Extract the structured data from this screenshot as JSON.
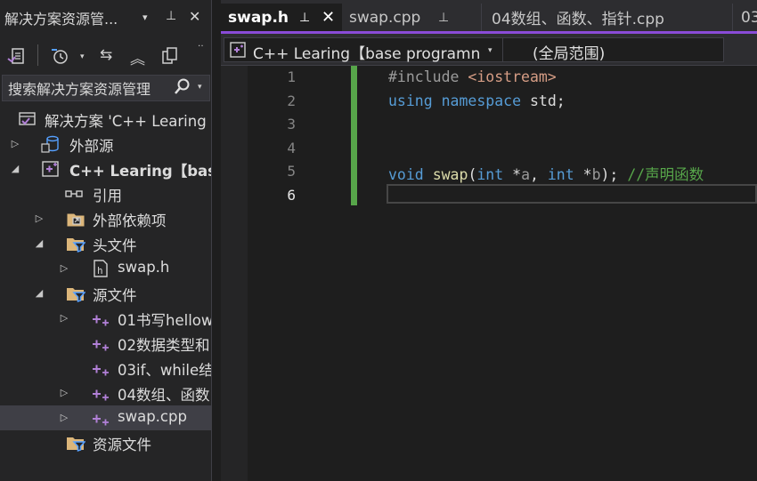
{
  "solution_explorer": {
    "title": "解决方案资源管...",
    "title_controls": {
      "dropdown": "▾",
      "pin": "⊥",
      "close": "✕"
    },
    "search_placeholder": "搜索解决方案资源管理",
    "tree": [
      {
        "label": "解决方案 'C++ Learing",
        "icon": "solution-icon",
        "expander": ""
      },
      {
        "label": "外部源",
        "icon": "external-sources-icon",
        "expander": "▷"
      },
      {
        "label": "C++ Learing【bas",
        "icon": "project-icon",
        "expander": "◢"
      },
      {
        "label": "引用",
        "icon": "references-icon",
        "expander": ""
      },
      {
        "label": "外部依赖项",
        "icon": "external-dependencies-icon",
        "expander": "▷"
      },
      {
        "label": "头文件",
        "icon": "filter-folder-icon",
        "expander": "◢"
      },
      {
        "label": "swap.h",
        "icon": "header-file-icon",
        "expander": "▷"
      },
      {
        "label": "源文件",
        "icon": "filter-folder-icon",
        "expander": "◢"
      },
      {
        "label": "01书写hellow",
        "icon": "cpp-file-icon",
        "expander": "▷"
      },
      {
        "label": "02数据类型和",
        "icon": "cpp-file-icon",
        "expander": ""
      },
      {
        "label": "03if、while结",
        "icon": "cpp-file-icon",
        "expander": ""
      },
      {
        "label": "04数组、函数",
        "icon": "cpp-file-icon",
        "expander": "▷"
      },
      {
        "label": "swap.cpp",
        "icon": "cpp-file-icon",
        "expander": "▷"
      },
      {
        "label": "资源文件",
        "icon": "filter-folder-icon",
        "expander": ""
      }
    ]
  },
  "tabs": [
    {
      "label": "swap.h",
      "active": true
    },
    {
      "label": "swap.cpp",
      "active": false
    },
    {
      "label": "04数组、函数、指针.cpp",
      "active": false
    },
    {
      "label": "03",
      "active": false
    }
  ],
  "navbar": {
    "project": "C++ Learing【base programn",
    "scope": "(全局范围)"
  },
  "editor": {
    "line_numbers": [
      "1",
      "2",
      "3",
      "4",
      "5",
      "6"
    ],
    "current_line": 6,
    "lines": [
      [
        {
          "t": "#include ",
          "c": "pp"
        },
        {
          "t": "<iostream>",
          "c": "str"
        }
      ],
      [
        {
          "t": "using",
          "c": "kw"
        },
        {
          "t": " ",
          "c": ""
        },
        {
          "t": "namespace",
          "c": "kw"
        },
        {
          "t": " std;",
          "c": ""
        }
      ],
      [],
      [],
      [
        {
          "t": "void",
          "c": "kw"
        },
        {
          "t": " ",
          "c": ""
        },
        {
          "t": "swap",
          "c": "fn"
        },
        {
          "t": "(",
          "c": ""
        },
        {
          "t": "int",
          "c": "kw"
        },
        {
          "t": " *",
          "c": ""
        },
        {
          "t": "a",
          "c": "pm"
        },
        {
          "t": ", ",
          "c": ""
        },
        {
          "t": "int",
          "c": "kw"
        },
        {
          "t": " *",
          "c": ""
        },
        {
          "t": "b",
          "c": "pm"
        },
        {
          "t": "); ",
          "c": ""
        },
        {
          "t": "//声明函数",
          "c": "cm"
        }
      ],
      []
    ]
  },
  "colors": {
    "accent": "#8a4bd8",
    "change_bar": "#57a64a",
    "keyword": "#569cd6",
    "comment": "#57a64a",
    "string": "#d69d85"
  }
}
